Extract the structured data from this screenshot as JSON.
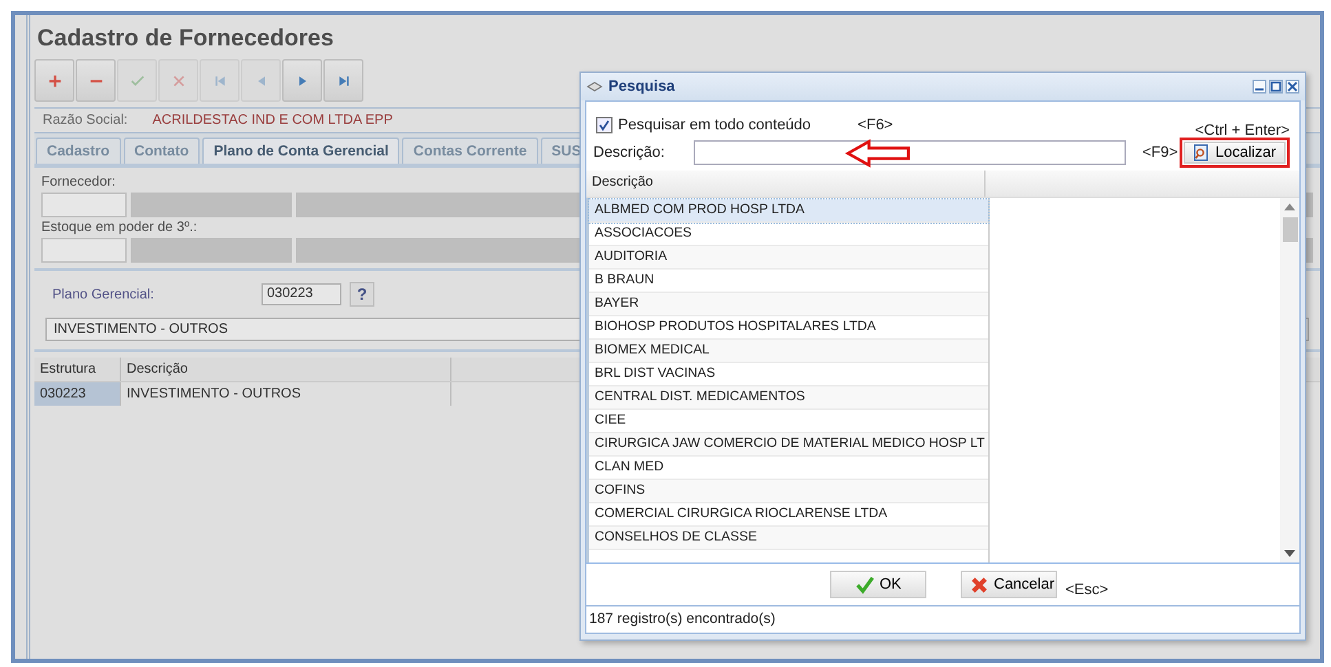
{
  "page": {
    "title": "Cadastro de Fornecedores",
    "toolbar": [
      {
        "kind": "add",
        "disabled": false
      },
      {
        "kind": "remove",
        "disabled": false
      },
      {
        "kind": "confirm",
        "disabled": true
      },
      {
        "kind": "cancel",
        "disabled": true
      },
      {
        "kind": "first",
        "disabled": true
      },
      {
        "kind": "prev",
        "disabled": true
      },
      {
        "kind": "next",
        "disabled": false
      },
      {
        "kind": "last",
        "disabled": false
      }
    ],
    "razao_social": {
      "label": "Razão Social:",
      "value": "ACRILDESTAC IND E COM LTDA EPP"
    },
    "tabs": [
      {
        "label": "Cadastro",
        "selected": false
      },
      {
        "label": "Contato",
        "selected": false
      },
      {
        "label": "Plano de Conta Gerencial",
        "selected": true
      },
      {
        "label": "Contas Corrente",
        "selected": false
      },
      {
        "label": "SUS",
        "selected": false
      }
    ],
    "fornecedor_label": "Fornecedor:",
    "estoque_label": "Estoque em poder de 3º.:",
    "plano_gerencial": {
      "label": "Plano Gerencial:",
      "code": "030223",
      "help": "?",
      "description": "INVESTIMENTO - OUTROS"
    },
    "table": {
      "columns": [
        "Estrutura",
        "Descrição"
      ],
      "rows": [
        {
          "cells": [
            "030223",
            "INVESTIMENTO - OUTROS"
          ],
          "selected": true
        }
      ]
    }
  },
  "dialog": {
    "title": "Pesquisa",
    "search_all": {
      "label": "Pesquisar em todo conteúdo",
      "checked": true,
      "shortcut": "<F6>"
    },
    "find_shortcut": "<Ctrl + Enter>",
    "field": {
      "label": "Descrição:",
      "shortcut": "<F9>"
    },
    "find_button": "Localizar",
    "grid": {
      "columns": [
        "Descrição"
      ],
      "rows": [
        {
          "text": "ALBMED COM PROD HOSP LTDA",
          "selected": true
        },
        {
          "text": "ASSOCIACOES",
          "selected": false
        },
        {
          "text": "AUDITORIA",
          "selected": false
        },
        {
          "text": "B BRAUN",
          "selected": false
        },
        {
          "text": "BAYER",
          "selected": false
        },
        {
          "text": "BIOHOSP PRODUTOS HOSPITALARES LTDA",
          "selected": false
        },
        {
          "text": "BIOMEX MEDICAL",
          "selected": false
        },
        {
          "text": "BRL DIST VACINAS",
          "selected": false
        },
        {
          "text": "CENTRAL DIST. MEDICAMENTOS",
          "selected": false
        },
        {
          "text": "CIEE",
          "selected": false
        },
        {
          "text": "CIRURGICA JAW COMERCIO DE MATERIAL MEDICO HOSP LT",
          "selected": false
        },
        {
          "text": "CLAN MED",
          "selected": false
        },
        {
          "text": "COFINS",
          "selected": false
        },
        {
          "text": "COMERCIAL CIRURGICA RIOCLARENSE LTDA",
          "selected": false
        },
        {
          "text": "CONSELHOS DE CLASSE",
          "selected": false
        }
      ]
    },
    "ok_button": "OK",
    "cancel_button": "Cancelar",
    "cancel_shortcut": "<Esc>",
    "status": "187 registro(s) encontrado(s)"
  }
}
